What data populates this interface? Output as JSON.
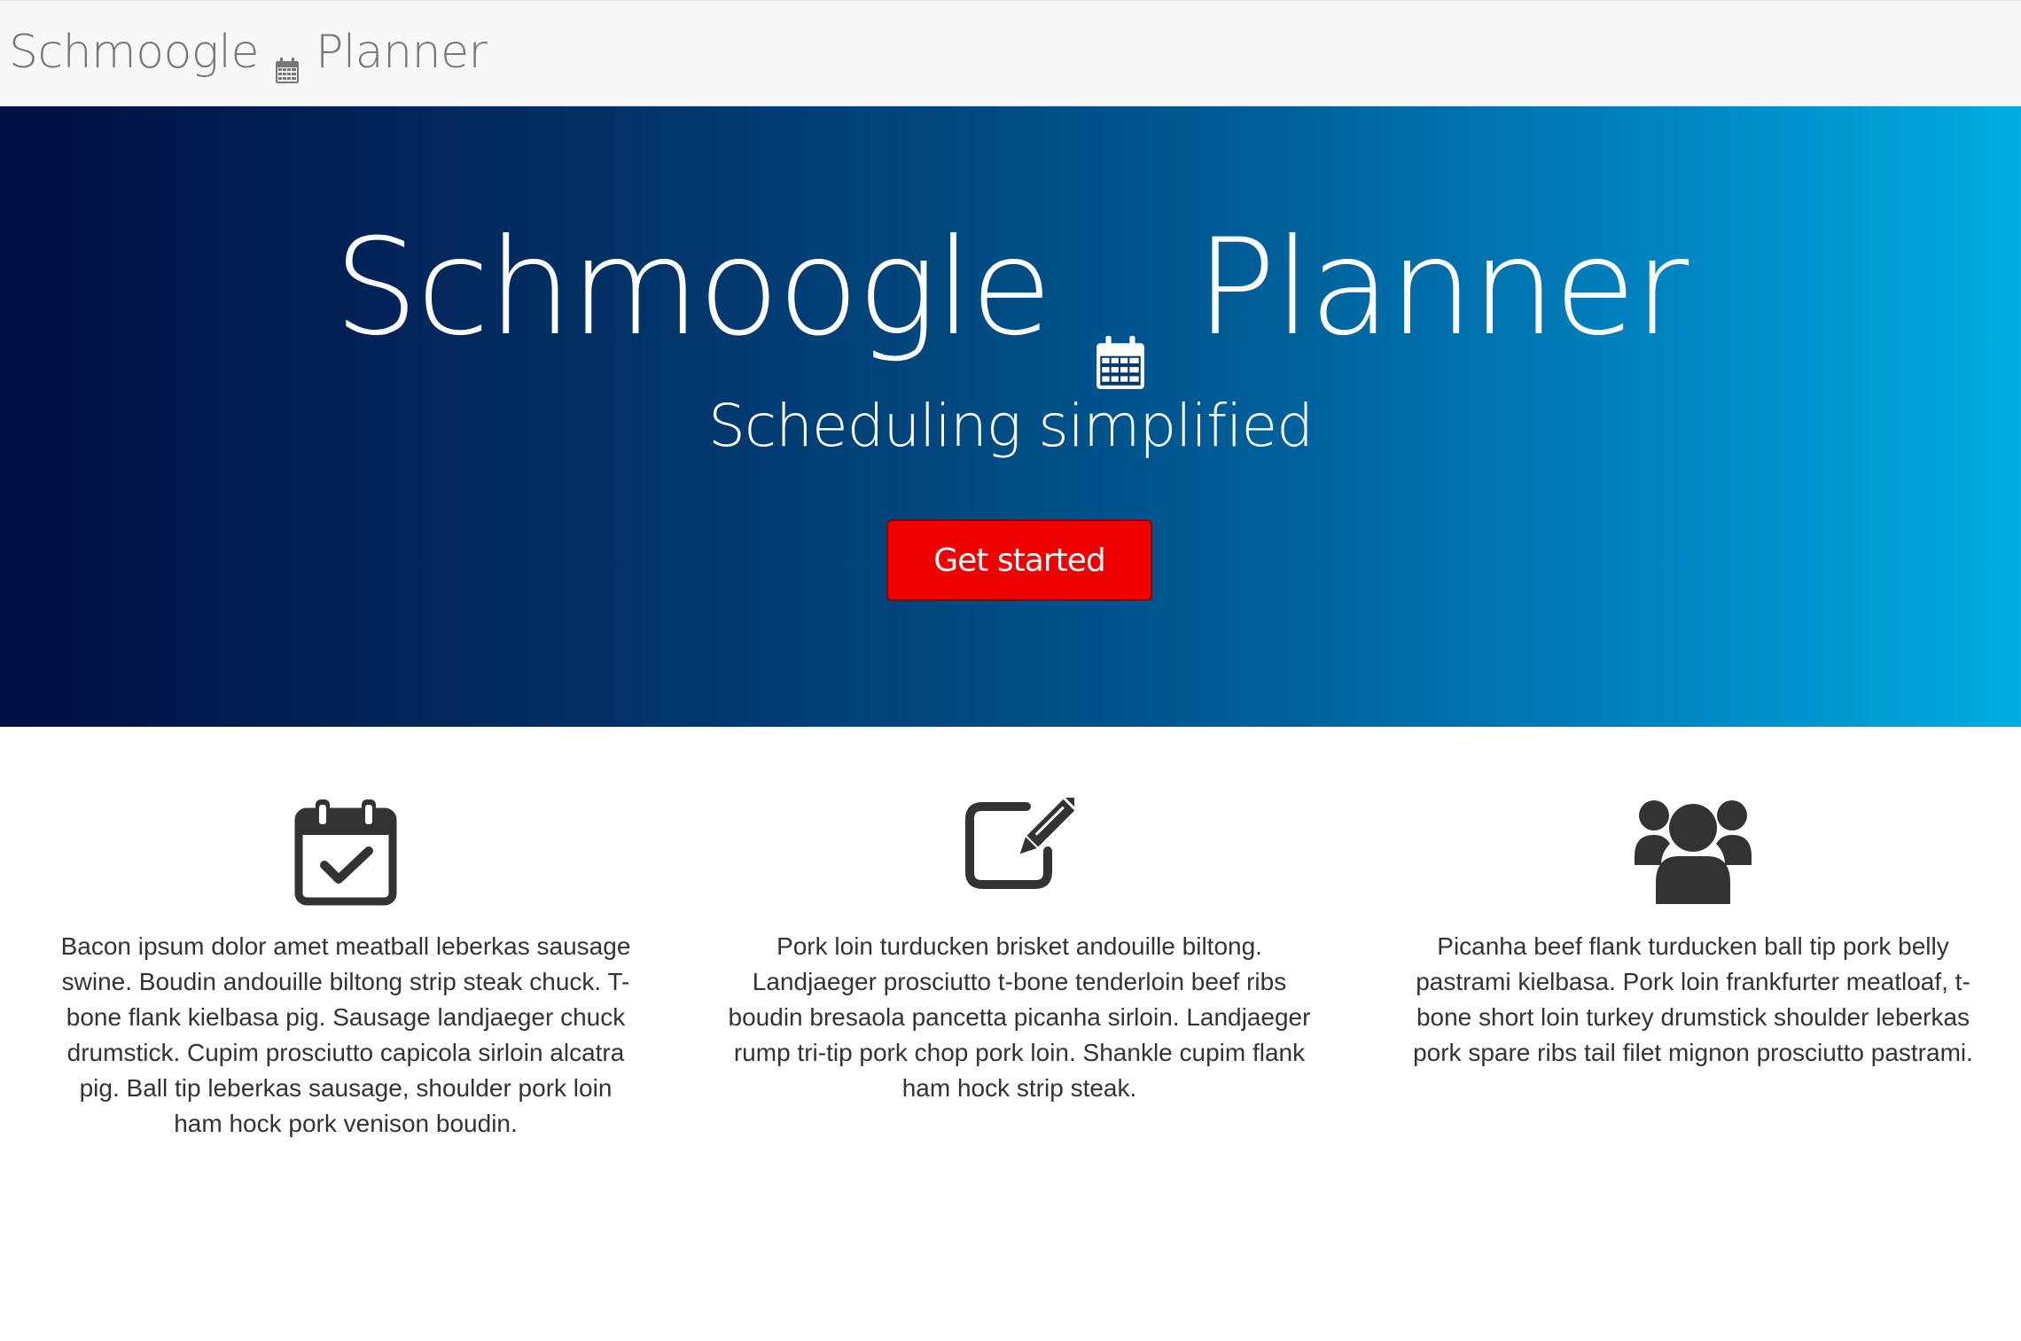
{
  "navbar": {
    "brand_left": "Schmoogle",
    "brand_right": "Planner",
    "brand_icon": "calendar-icon"
  },
  "hero": {
    "title_left": "Schmoogle",
    "title_right": "Planner",
    "title_icon": "calendar-icon",
    "subtitle": "Scheduling simplified",
    "cta_label": "Get started",
    "gradient_start": "#010f42",
    "gradient_end": "#00adde",
    "cta_color": "#ee0000"
  },
  "features": [
    {
      "icon": "calendar-check-icon",
      "text": "Bacon ipsum dolor amet meatball leberkas sausage swine. Boudin andouille biltong strip steak chuck. T-bone flank kielbasa pig. Sausage landjaeger chuck drumstick. Cupim prosciutto capicola sirloin alcatra pig. Ball tip leberkas sausage, shoulder pork loin ham hock pork venison boudin."
    },
    {
      "icon": "edit-icon",
      "text": "Pork loin turducken brisket andouille biltong. Landjaeger prosciutto t-bone tenderloin beef ribs boudin bresaola pancetta picanha sirloin. Landjaeger rump tri-tip pork chop pork loin. Shankle cupim flank ham hock strip steak."
    },
    {
      "icon": "users-icon",
      "text": "Picanha beef flank turducken ball tip pork belly pastrami kielbasa. Pork loin frankfurter meatloaf, t-bone short loin turkey drumstick shoulder leberkas pork spare ribs tail filet mignon prosciutto pastrami."
    }
  ]
}
